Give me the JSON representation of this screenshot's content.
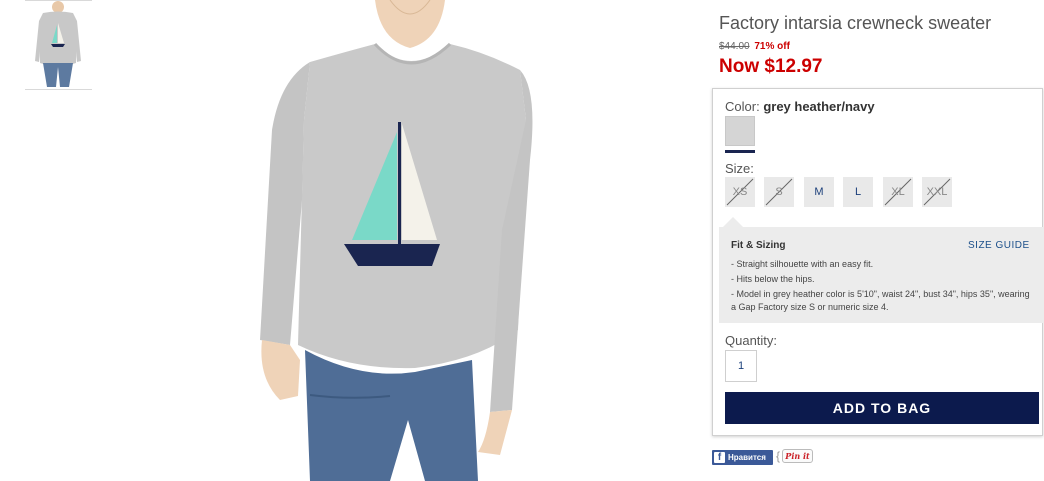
{
  "product": {
    "title": "Factory intarsia crewneck sweater",
    "original_price": "$44.00",
    "percent_off": "71% off",
    "sale_price": "Now $12.97"
  },
  "color": {
    "label": "Color:",
    "selected": "grey heather/navy",
    "swatch_color": "#d5d5d5"
  },
  "size": {
    "label": "Size:",
    "options": [
      {
        "label": "XS",
        "available": false
      },
      {
        "label": "S",
        "available": false
      },
      {
        "label": "M",
        "available": true
      },
      {
        "label": "L",
        "available": true
      },
      {
        "label": "XL",
        "available": false
      },
      {
        "label": "XXL",
        "available": false
      }
    ]
  },
  "fit": {
    "title": "Fit & Sizing",
    "size_guide": "SIZE GUIDE",
    "items": [
      "- Straight silhouette with an easy fit.",
      "- Hits below the hips.",
      "- Model in grey heather color is 5'10\", waist 24\", bust 34\", hips 35\", wearing a Gap Factory size S or numeric size 4."
    ]
  },
  "quantity": {
    "label": "Quantity:",
    "value": "1"
  },
  "add_to_bag": "ADD TO BAG",
  "social": {
    "facebook_label": "Нравится",
    "pinterest_label": "Pin it"
  },
  "colors": {
    "sale_red": "#cc0000",
    "navy_button": "#0c1a4d",
    "link_blue": "#1b4f8a",
    "sweater_grey": "#c8c8c8",
    "sail_mint": "#7ad9c8"
  }
}
